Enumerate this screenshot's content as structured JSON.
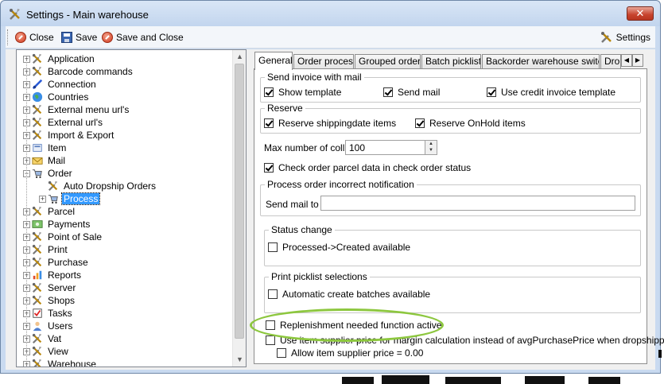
{
  "window": {
    "title": "Settings - Main warehouse",
    "close_glyph": "✕"
  },
  "toolbar": {
    "close_label": "Close",
    "save_label": "Save",
    "save_close_label": "Save and Close",
    "settings_label": "Settings"
  },
  "tree": {
    "items": [
      {
        "label": "Application",
        "icon": "tools-icon"
      },
      {
        "label": "Barcode commands",
        "icon": "tools-icon"
      },
      {
        "label": "Connection",
        "icon": "connection-icon"
      },
      {
        "label": "Countries",
        "icon": "globe-icon"
      },
      {
        "label": "External menu url's",
        "icon": "tools-icon"
      },
      {
        "label": "External url's",
        "icon": "tools-icon"
      },
      {
        "label": "Import & Export",
        "icon": "tools-icon"
      },
      {
        "label": "Item",
        "icon": "item-icon"
      },
      {
        "label": "Mail",
        "icon": "mail-icon"
      },
      {
        "label": "Order",
        "icon": "cart-icon"
      },
      {
        "label": "Auto Dropship Orders",
        "icon": "tools-icon"
      },
      {
        "label": "Process",
        "icon": "cart-icon"
      },
      {
        "label": "Parcel",
        "icon": "tools-icon"
      },
      {
        "label": "Payments",
        "icon": "payments-icon"
      },
      {
        "label": "Point of Sale",
        "icon": "tools-icon"
      },
      {
        "label": "Print",
        "icon": "tools-icon"
      },
      {
        "label": "Purchase",
        "icon": "tools-icon"
      },
      {
        "label": "Reports",
        "icon": "reports-icon"
      },
      {
        "label": "Server",
        "icon": "tools-icon"
      },
      {
        "label": "Shops",
        "icon": "tools-icon"
      },
      {
        "label": "Tasks",
        "icon": "tasks-icon"
      },
      {
        "label": "Users",
        "icon": "users-icon"
      },
      {
        "label": "Vat",
        "icon": "tools-icon"
      },
      {
        "label": "View",
        "icon": "tools-icon"
      },
      {
        "label": "Warehouse",
        "icon": "tools-icon"
      }
    ],
    "selected": "Process"
  },
  "tabs": [
    {
      "label": "General",
      "active": true
    },
    {
      "label": "Order process"
    },
    {
      "label": "Grouped orders"
    },
    {
      "label": "Batch picklist"
    },
    {
      "label": "Backorder warehouse switch"
    },
    {
      "label": "Dro"
    }
  ],
  "general": {
    "send_invoice": {
      "title": "Send invoice with mail",
      "show_template": "Show template",
      "send_mail": "Send mail",
      "use_credit": "Use credit invoice template"
    },
    "reserve": {
      "title": "Reserve",
      "shippingdate": "Reserve shippingdate items",
      "onhold": "Reserve OnHold items"
    },
    "max_colli_label": "Max number of colli",
    "max_colli_value": "100",
    "check_parcel": "Check order parcel data in check order status",
    "incorrect": {
      "title": "Process order incorrect notification",
      "send_mail_to": "Send mail to",
      "send_mail_value": ""
    },
    "status_change": {
      "title": "Status change",
      "processed_created": "Processed->Created available"
    },
    "print_picklist": {
      "title": "Print picklist selections",
      "auto_batches": "Automatic create batches available"
    },
    "replenishment": "Replenishment needed function active",
    "use_supplier_price": "Use item supplier price for margin calculation instead of avgPurchasePrice when dropshipped",
    "allow_supplier_zero": "Allow item supplier price = 0.00"
  },
  "colors": {
    "highlight_oval": "#8dc73f",
    "selection": "#3399ff"
  }
}
